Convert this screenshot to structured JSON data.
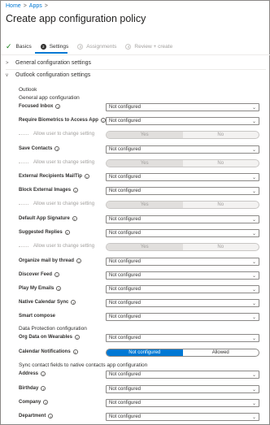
{
  "breadcrumb": {
    "home": "Home",
    "separator": ">",
    "apps": "Apps",
    "trailing": ">"
  },
  "page_title": "Create app configuration policy",
  "wizard": {
    "steps": [
      {
        "number": "",
        "label": "Basics",
        "state": "done"
      },
      {
        "number": "2",
        "label": "Settings",
        "state": "active"
      },
      {
        "number": "3",
        "label": "Assignments",
        "state": "pending"
      },
      {
        "number": "4",
        "label": "Review + create",
        "state": "pending"
      }
    ]
  },
  "sections": {
    "general": {
      "label": "General configuration settings",
      "expanded": false
    },
    "outlook": {
      "label": "Outlook configuration settings",
      "expanded": true
    }
  },
  "headings": {
    "outlook": "Outlook",
    "general_app": "General app configuration",
    "data_protection": "Data Protection configuration",
    "sync_contacts": "Sync contact fields to native contacts app configuration"
  },
  "dropdown_default": "Not configured",
  "allow_label": "Allow user to change setting",
  "toggle_yes": "Yes",
  "toggle_no": "No",
  "settings": {
    "focused_inbox": "Focused Inbox",
    "require_biometrics": "Require Biometrics to Access App",
    "save_contacts": "Save Contacts",
    "external_recipients": "External Recipients MailTip",
    "block_external_images": "Block External Images",
    "default_app_signature": "Default App Signature",
    "suggested_replies": "Suggested Replies",
    "organize_mail": "Organize mail by thread",
    "discover_feed": "Discover Feed",
    "play_my_emails": "Play My Emails",
    "native_calendar_sync": "Native Calendar Sync",
    "smart_compose": "Smart compose",
    "org_data_wearables": "Org Data on Wearables",
    "calendar_notifications": "Calendar Notifications",
    "address": "Address",
    "birthday": "Birthday",
    "company": "Company",
    "department": "Department"
  },
  "calendar_toggle": {
    "left": "Not configured",
    "right": "Allowed",
    "selected": "left"
  },
  "colors": {
    "accent": "#0078d4",
    "check": "#107c10",
    "border": "#8a8886"
  },
  "icons": {
    "info": "info-icon",
    "dropdown": "chevron-down-icon",
    "done": "checkmark-icon"
  }
}
